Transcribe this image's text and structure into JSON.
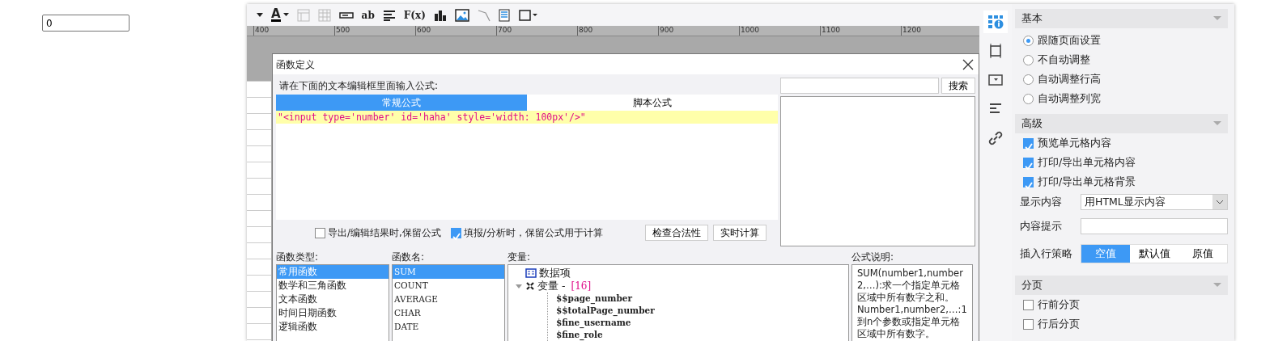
{
  "number_input": {
    "value": "0"
  },
  "toolbar": [
    {
      "kind": "caret"
    },
    {
      "kind": "font-color",
      "label": "A"
    },
    {
      "kind": "table",
      "disabled": true
    },
    {
      "kind": "grid",
      "disabled": true
    },
    {
      "kind": "input-box"
    },
    {
      "kind": "glyph",
      "label": "ab"
    },
    {
      "kind": "align"
    },
    {
      "kind": "glyph",
      "label": "F(x)"
    },
    {
      "kind": "bar-chart"
    },
    {
      "kind": "image"
    },
    {
      "kind": "slash"
    },
    {
      "kind": "document"
    },
    {
      "kind": "border"
    }
  ],
  "ruler": [
    "400",
    "500",
    "600",
    "700",
    "800",
    "900",
    "1000",
    "1100",
    "1200"
  ],
  "dialog": {
    "title": "函数定义",
    "prompt": "请在下面的文本编辑框里面输入公式:",
    "search_button": "搜索",
    "tabs": [
      {
        "label": "常规公式",
        "selected": true
      },
      {
        "label": "脚本公式",
        "selected": false
      }
    ],
    "formula": "\"<input type='number' id='haha' style='width: 100px'/>\"",
    "options": [
      {
        "label": "导出/编辑结果时,保留公式",
        "checked": false
      },
      {
        "label": "填报/分析时，保留公式用于计算",
        "checked": true
      }
    ],
    "buttons": [
      "检查合法性",
      "实时计算"
    ],
    "function_types": {
      "label": "函数类型:",
      "items": [
        {
          "label": "常用函数",
          "selected": true
        },
        {
          "label": "数学和三角函数",
          "selected": false
        },
        {
          "label": "文本函数",
          "selected": false
        },
        {
          "label": "时间日期函数",
          "selected": false
        },
        {
          "label": "逻辑函数",
          "selected": false
        }
      ]
    },
    "function_names": {
      "label": "函数名:",
      "items": [
        {
          "label": "SUM",
          "selected": true
        },
        {
          "label": "COUNT",
          "selected": false
        },
        {
          "label": "AVERAGE",
          "selected": false
        },
        {
          "label": "CHAR",
          "selected": false
        },
        {
          "label": "DATE",
          "selected": false
        }
      ]
    },
    "variables": {
      "label": "变量:",
      "tree": [
        {
          "kind": "dataset",
          "label": "数据项"
        },
        {
          "kind": "variable",
          "label": "变量 - ",
          "count": "[16]",
          "expanded": true,
          "children": [
            {
              "label": "$$page_number"
            },
            {
              "label": "$$totalPage_number"
            },
            {
              "label": "$fine_username"
            },
            {
              "label": "$fine_role"
            }
          ]
        }
      ]
    },
    "description": {
      "label": "公式说明:",
      "paragraphs": [
        "SUM(number1,number2,…):求一个指定单元格区域中所有数字之和。",
        "Number1,number2,…:1到n个参数或指定单元格区域中所有数字。"
      ]
    }
  },
  "side_icons": [
    {
      "kind": "cell-info",
      "selected": true
    },
    {
      "kind": "frame",
      "selected": false
    },
    {
      "kind": "dropdown",
      "selected": false
    },
    {
      "kind": "align",
      "selected": false
    },
    {
      "kind": "link",
      "selected": false
    }
  ],
  "panel": {
    "basic": {
      "title": "基本",
      "options": [
        {
          "label": "跟随页面设置",
          "selected": true
        },
        {
          "label": "不自动调整",
          "selected": false
        },
        {
          "label": "自动调整行高",
          "selected": false
        },
        {
          "label": "自动调整列宽",
          "selected": false
        }
      ]
    },
    "advanced": {
      "title": "高级",
      "checks": [
        {
          "label": "预览单元格内容",
          "checked": true
        },
        {
          "label": "打印/导出单元格内容",
          "checked": true
        },
        {
          "label": "打印/导出单元格背景",
          "checked": true
        }
      ],
      "display": {
        "label": "显示内容",
        "value": "用HTML显示内容"
      },
      "hint": {
        "label": "内容提示"
      },
      "insert_policy": {
        "label": "插入行策略",
        "options": [
          {
            "label": "空值",
            "selected": true
          },
          {
            "label": "默认值",
            "selected": false
          },
          {
            "label": "原值",
            "selected": false
          }
        ]
      }
    },
    "paging": {
      "title": "分页",
      "checks": [
        {
          "label": "行前分页",
          "checked": false
        },
        {
          "label": "行后分页",
          "checked": false
        }
      ]
    }
  }
}
